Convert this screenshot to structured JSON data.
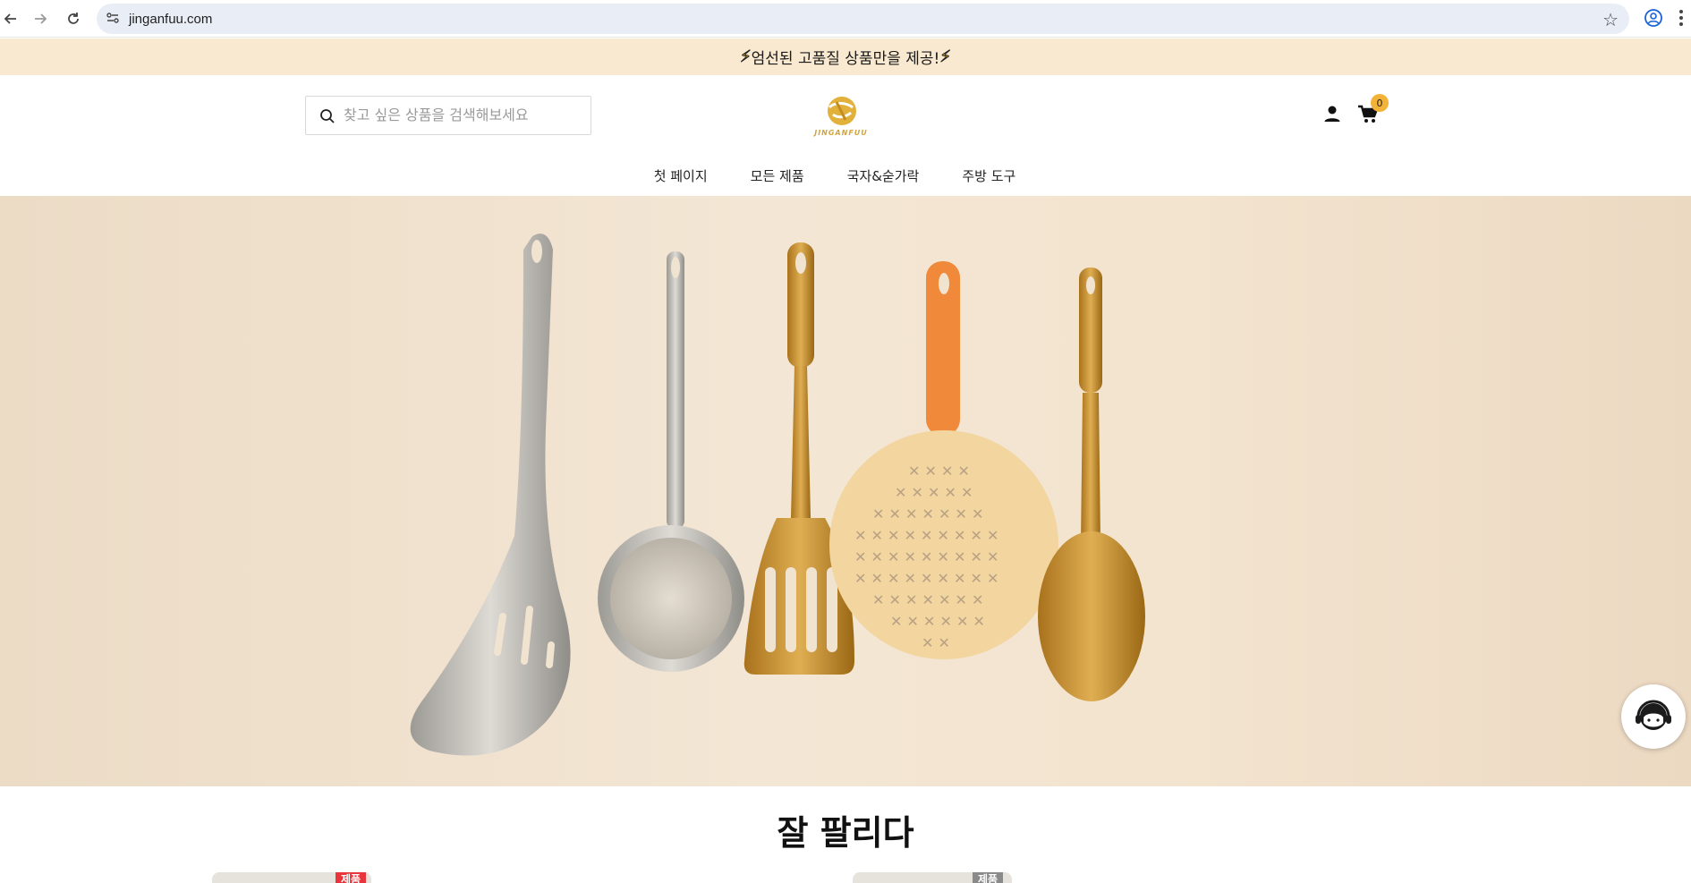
{
  "browser": {
    "url": "jinganfuu.com"
  },
  "announcement": {
    "icon": "lightning-icon",
    "text": "엄선된 고품질 상품만을 제공!"
  },
  "header": {
    "search_placeholder": "찾고 싶은 상품을 검색해보세요",
    "logo_text": "JINGANFUU",
    "cart_count": "0"
  },
  "nav": {
    "items": [
      {
        "label": "첫 페이지"
      },
      {
        "label": "모든 제품"
      },
      {
        "label": "국자&숟가락"
      },
      {
        "label": "주방 도구"
      }
    ]
  },
  "colors": {
    "announcement_bg": "#f8e9d0",
    "cart_badge": "#f2b338",
    "hero_bg": "#f3e6d4",
    "tag_red": "#e8353b",
    "tag_gray": "#8a8a8a"
  },
  "section": {
    "title": "잘 팔리다"
  },
  "products": [
    {
      "tag": "제품"
    },
    {
      "tag": "제품"
    }
  ]
}
